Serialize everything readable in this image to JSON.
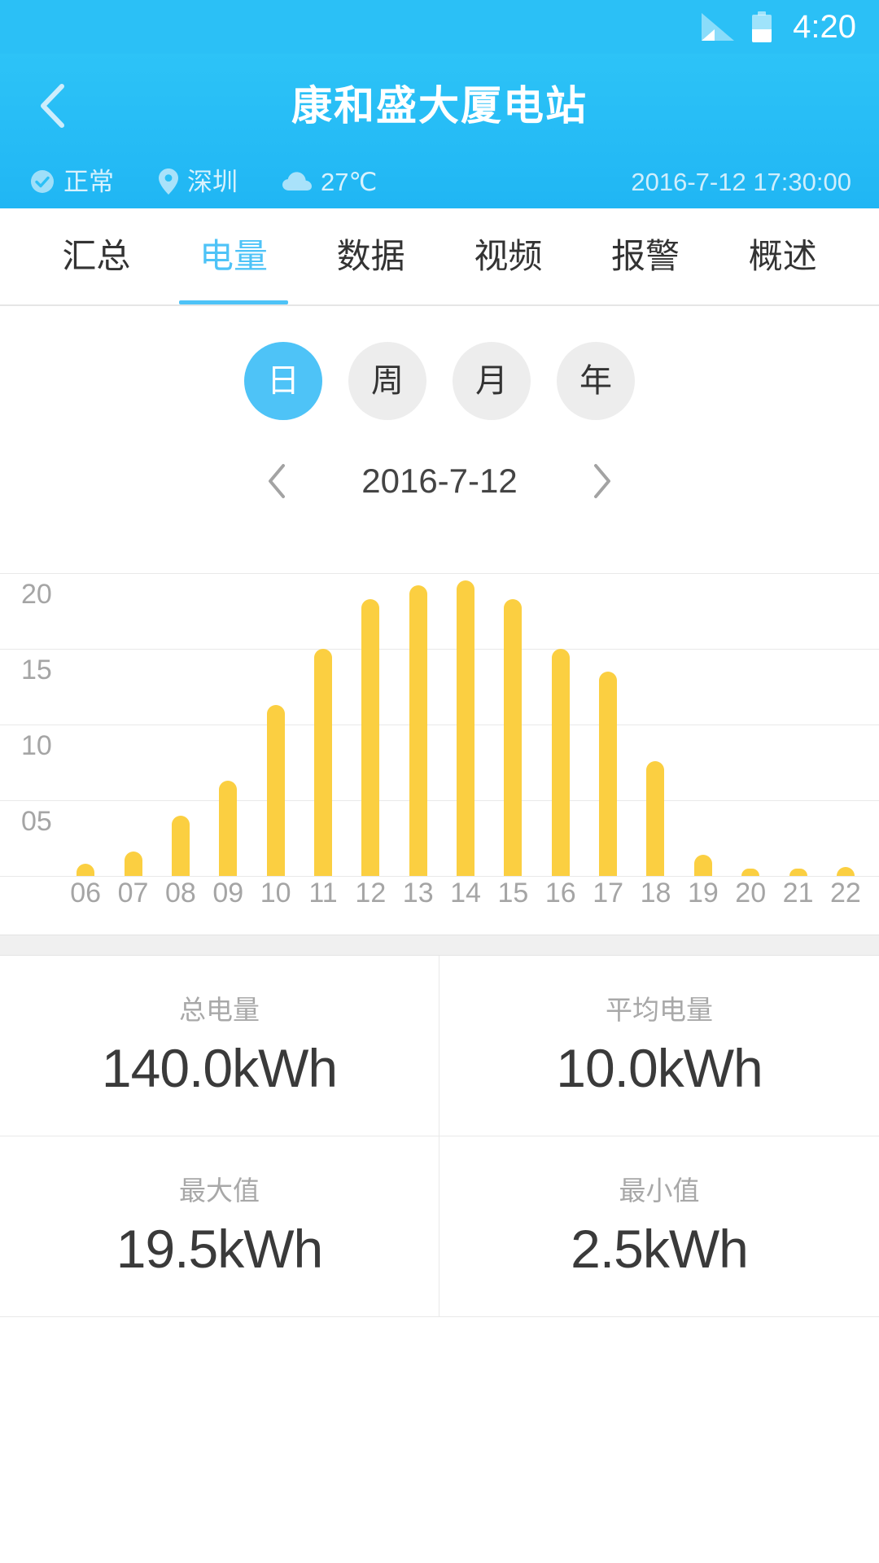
{
  "status_bar": {
    "time": "4:20",
    "signal_icon": "signal-bars-icon",
    "battery_icon": "battery-half-icon"
  },
  "header": {
    "back_icon": "back-chevron-icon",
    "title": "康和盛大厦电站",
    "status": {
      "icon": "check-circle-icon",
      "label": "正常"
    },
    "location": {
      "icon": "location-pin-icon",
      "label": "深圳"
    },
    "weather": {
      "icon": "cloud-icon",
      "label": "27℃"
    },
    "timestamp": "2016-7-12 17:30:00",
    "accent_color": "#2BC0F6"
  },
  "tabs": [
    {
      "label": "汇总",
      "active": false
    },
    {
      "label": "电量",
      "active": true
    },
    {
      "label": "数据",
      "active": false
    },
    {
      "label": "视频",
      "active": false
    },
    {
      "label": "报警",
      "active": false
    },
    {
      "label": "概述",
      "active": false
    }
  ],
  "period_selector": [
    {
      "label": "日",
      "active": true
    },
    {
      "label": "周",
      "active": false
    },
    {
      "label": "月",
      "active": false
    },
    {
      "label": "年",
      "active": false
    }
  ],
  "date_nav": {
    "prev_icon": "chevron-left-icon",
    "next_icon": "chevron-right-icon",
    "date": "2016-7-12"
  },
  "chart_data": {
    "type": "bar",
    "title": "",
    "xlabel": "",
    "ylabel": "",
    "unit": "kWh",
    "grid": true,
    "legend": "none",
    "ylim": [
      0,
      21.5
    ],
    "yticks": [
      5,
      10,
      15,
      20
    ],
    "ytick_labels": [
      "05",
      "10",
      "15",
      "20"
    ],
    "categories": [
      "06",
      "07",
      "08",
      "09",
      "10",
      "11",
      "12",
      "13",
      "14",
      "15",
      "16",
      "17",
      "18",
      "19",
      "20",
      "21",
      "22"
    ],
    "values": [
      0.8,
      1.6,
      4.0,
      6.3,
      11.3,
      15.0,
      18.3,
      19.2,
      19.5,
      18.3,
      15.0,
      13.5,
      7.6,
      1.4,
      0.5,
      0.5,
      0.6
    ],
    "bar_color": "#FBCF41"
  },
  "stats": [
    {
      "label": "总电量",
      "value": "140.0kWh"
    },
    {
      "label": "平均电量",
      "value": "10.0kWh"
    },
    {
      "label": "最大值",
      "value": "19.5kWh"
    },
    {
      "label": "最小值",
      "value": "2.5kWh"
    }
  ]
}
